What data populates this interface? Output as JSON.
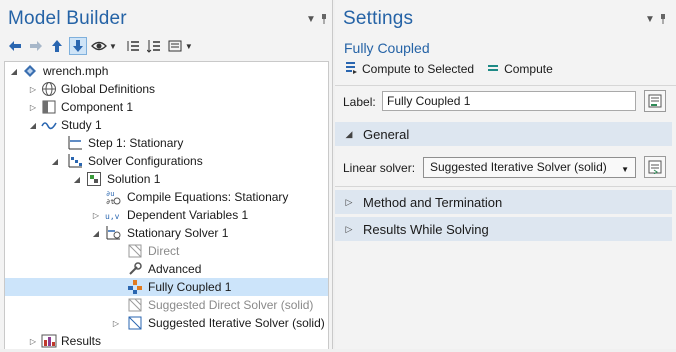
{
  "model_builder": {
    "title": "Model Builder",
    "tree": [
      {
        "label": "wrench.mph"
      },
      {
        "label": "Global Definitions"
      },
      {
        "label": "Component 1"
      },
      {
        "label": "Study 1"
      },
      {
        "label": "Step 1: Stationary"
      },
      {
        "label": "Solver Configurations"
      },
      {
        "label": "Solution 1"
      },
      {
        "label": "Compile Equations: Stationary"
      },
      {
        "label": "Dependent Variables 1"
      },
      {
        "label": "Stationary Solver 1"
      },
      {
        "label": "Direct"
      },
      {
        "label": "Advanced"
      },
      {
        "label": "Fully Coupled 1"
      },
      {
        "label": "Suggested Direct Solver (solid)"
      },
      {
        "label": "Suggested Iterative Solver (solid)"
      },
      {
        "label": "Results"
      }
    ]
  },
  "settings": {
    "title": "Settings",
    "subtitle": "Fully Coupled",
    "compute_to_selected": "Compute to Selected",
    "compute": "Compute",
    "label_caption": "Label:",
    "label_value": "Fully Coupled 1",
    "sections": {
      "general": "General",
      "method": "Method and Termination",
      "results_while": "Results While Solving"
    },
    "linear_solver_caption": "Linear solver:",
    "linear_solver_value": "Suggested Iterative Solver (solid)"
  }
}
